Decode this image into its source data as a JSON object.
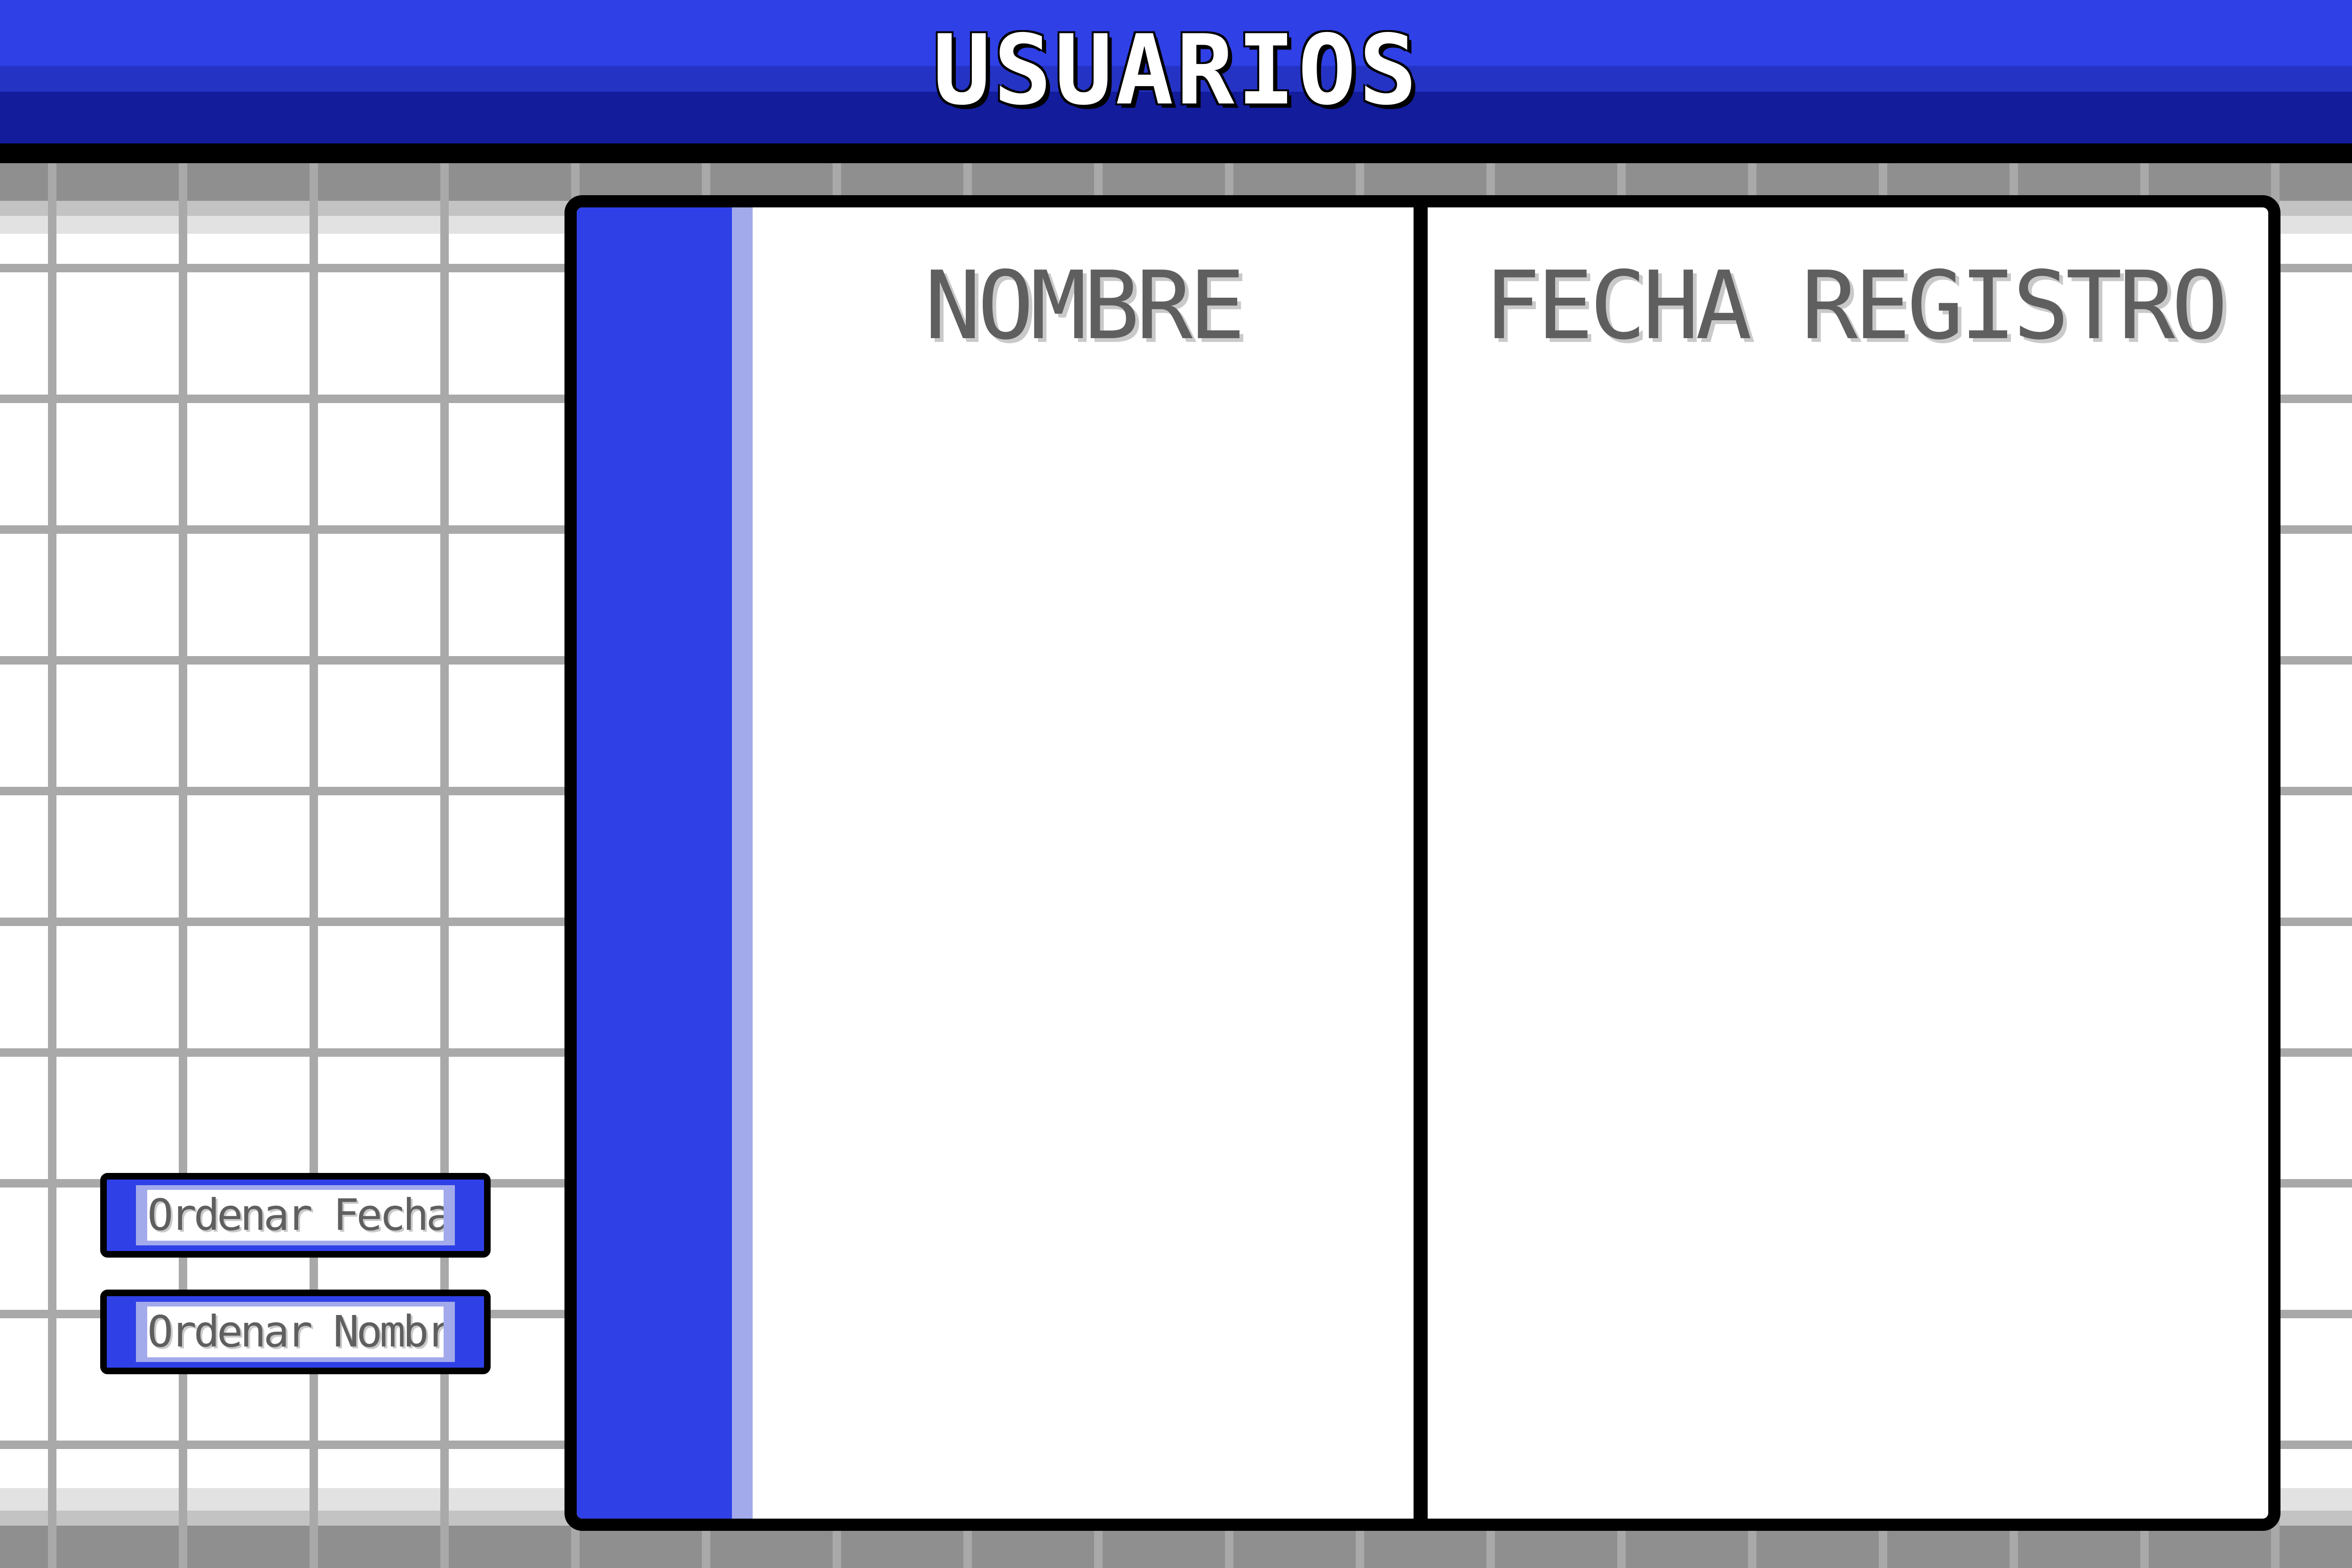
{
  "window": {
    "title": "USUARIOS"
  },
  "table": {
    "columns": [
      {
        "label": "NOMBRE"
      },
      {
        "label": "FECHA REGISTRO"
      }
    ],
    "rows": []
  },
  "actions": {
    "sort_by_date_label": "Ordenar Fecha",
    "sort_by_name_label": "Ordenar Nombre"
  },
  "colors": {
    "accent_blue": "#2f40e6",
    "dark_blue": "#131c9b",
    "light_blue": "#a2aaec",
    "header_text": "#5f5f5f",
    "grid_line": "#a9a9a9",
    "border": "#000000"
  }
}
